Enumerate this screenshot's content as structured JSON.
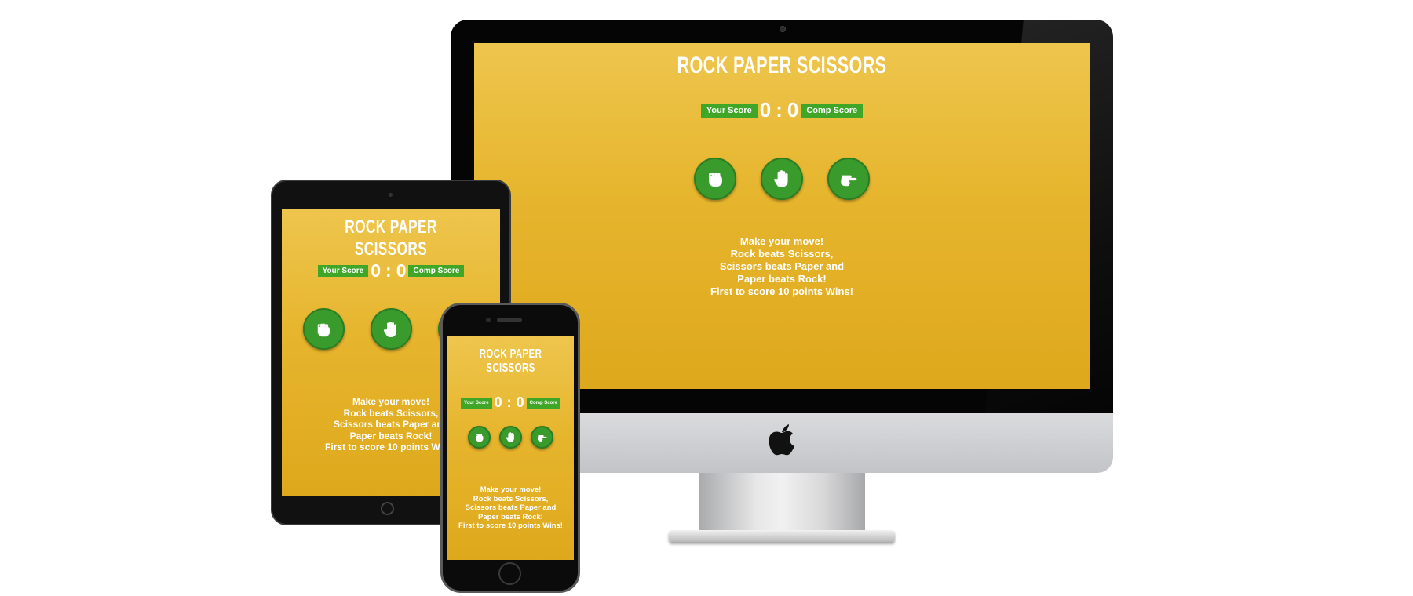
{
  "game": {
    "title": "ROCK PAPER SCISSORS",
    "your_score_label": "Your Score",
    "comp_score_label": "Comp Score",
    "user_score": "0",
    "separator": ":",
    "comp_score": "0",
    "choices": [
      {
        "name": "rock",
        "icon": "fist-icon"
      },
      {
        "name": "paper",
        "icon": "open-hand-icon"
      },
      {
        "name": "scissors",
        "icon": "scissors-hand-icon"
      }
    ],
    "message_lines": [
      "Make your move!",
      "Rock beats Scissors,",
      "Scissors beats Paper and",
      "Paper beats Rock!",
      "First to score 10 points Wins!"
    ]
  },
  "colors": {
    "background_top": "#eec54d",
    "background_bottom": "#dea81c",
    "badge_green": "#3fa628",
    "button_green": "#3a9b2d",
    "text": "#ffffff"
  },
  "devices": [
    "imac",
    "ipad",
    "iphone"
  ],
  "brand_icon": "apple-logo-icon"
}
